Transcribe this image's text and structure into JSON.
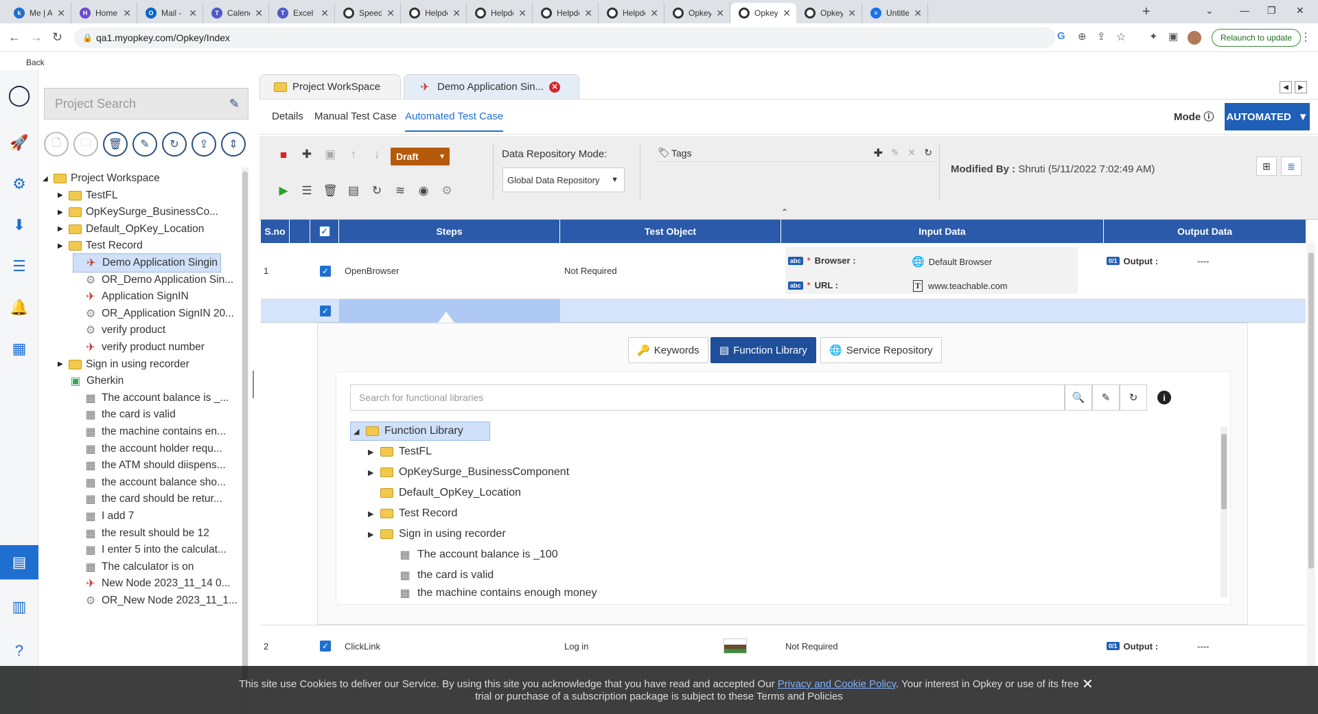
{
  "browser": {
    "tabs": [
      {
        "title": "Me | Atte",
        "fav": "k",
        "color": "#1f6fd1"
      },
      {
        "title": "Home | M",
        "fav": "H",
        "color": "#6a4ad1"
      },
      {
        "title": "Mail - Sa",
        "fav": "O",
        "color": "#0a64c8"
      },
      {
        "title": "Calendar",
        "fav": "T",
        "color": "#5059c9"
      },
      {
        "title": "Excel | M",
        "fav": "T",
        "color": "#5059c9"
      },
      {
        "title": "Speed up",
        "fav": "",
        "color": "ring"
      },
      {
        "title": "Helpdesk",
        "fav": "",
        "color": "ring"
      },
      {
        "title": "Helpdesk",
        "fav": "",
        "color": "ring"
      },
      {
        "title": "Helpdesk",
        "fav": "",
        "color": "ring"
      },
      {
        "title": "Helpdesk",
        "fav": "",
        "color": "ring"
      },
      {
        "title": "Opkey La",
        "fav": "",
        "color": "ring"
      },
      {
        "title": "Opkey",
        "fav": "",
        "color": "ring"
      },
      {
        "title": "Opkey Ur",
        "fav": "",
        "color": "ring"
      },
      {
        "title": "Untitled",
        "fav": "≡",
        "color": "#1a73e8"
      }
    ],
    "url": "qa1.myopkey.com/Opkey/Index",
    "relaunch": "Relaunch to update",
    "back": "Back"
  },
  "sidebar": {
    "search_placeholder": "Project Search",
    "tree": [
      {
        "label": "Project Workspace",
        "type": "folder",
        "level": 0,
        "expand": "open"
      },
      {
        "label": "TestFL",
        "type": "folder",
        "level": 1,
        "expand": "closed"
      },
      {
        "label": "OpKeySurge_BusinessCo...",
        "type": "folder",
        "level": 1,
        "expand": "closed"
      },
      {
        "label": "Default_OpKey_Location",
        "type": "folder",
        "level": 1,
        "expand": "closed"
      },
      {
        "label": "Test Record",
        "type": "folder",
        "level": 1,
        "expand": "closed"
      },
      {
        "label": "Demo Application Singin",
        "type": "tc",
        "level": 2,
        "selected": true
      },
      {
        "label": "OR_Demo Application Sin...",
        "type": "or",
        "level": 2
      },
      {
        "label": "Application SignIN",
        "type": "tc",
        "level": 2
      },
      {
        "label": "OR_Application SignIN 20...",
        "type": "or",
        "level": 2
      },
      {
        "label": "verify product",
        "type": "or",
        "level": 2
      },
      {
        "label": "verify product number",
        "type": "tc",
        "level": 2
      },
      {
        "label": "Sign in using recorder",
        "type": "folder",
        "level": 1,
        "expand": "closed"
      },
      {
        "label": "Gherkin",
        "type": "gherkin",
        "level": 1
      },
      {
        "label": "The account balance is _...",
        "type": "bc",
        "level": 2
      },
      {
        "label": "the card is valid",
        "type": "bc",
        "level": 2
      },
      {
        "label": "the machine contains en...",
        "type": "bc",
        "level": 2
      },
      {
        "label": "the account holder requ...",
        "type": "bc",
        "level": 2
      },
      {
        "label": "the ATM should diispens...",
        "type": "bc",
        "level": 2
      },
      {
        "label": "the account balance sho...",
        "type": "bc",
        "level": 2
      },
      {
        "label": "the card should be retur...",
        "type": "bc",
        "level": 2
      },
      {
        "label": "I add 7",
        "type": "bc",
        "level": 2
      },
      {
        "label": "the result should be 12",
        "type": "bc",
        "level": 2
      },
      {
        "label": "I enter 5 into the calculat...",
        "type": "bc",
        "level": 2
      },
      {
        "label": "The calculator is on",
        "type": "bc",
        "level": 2
      },
      {
        "label": "New Node 2023_11_14 0...",
        "type": "tc",
        "level": 2
      },
      {
        "label": "OR_New Node 2023_11_1...",
        "type": "or",
        "level": 2
      }
    ]
  },
  "workspace": {
    "tab_workspace": "Project WorkSpace",
    "tab_active": "Demo Application Sin...",
    "subtabs": [
      "Details",
      "Manual Test Case",
      "Automated Test Case"
    ],
    "mode_label": "Mode",
    "mode_value": "AUTOMATED"
  },
  "toolbar": {
    "status": "Draft",
    "drm_label": "Data Repository Mode:",
    "drm_value": "Global Data Repository",
    "tags_label": "Tags",
    "modified_label": "Modified By :",
    "modified_value": "Shruti (5/11/2022 7:02:49 AM)"
  },
  "grid": {
    "headers": [
      "S.no",
      "",
      "Steps",
      "Test Object",
      "Input Data",
      "Output Data"
    ],
    "rows": [
      {
        "sno": "1",
        "step": "OpenBrowser",
        "object": "Not Required",
        "inputs": [
          {
            "label": "Browser :",
            "value": "Default Browser"
          },
          {
            "label": "URL :",
            "value": "www.teachable.com"
          }
        ],
        "output_label": "Output :",
        "output_value": "----"
      },
      {
        "sno": "2",
        "step": "ClickLink",
        "object": "Log in",
        "input_text": "Not Required",
        "output_label": "Output :",
        "output_value": "----"
      }
    ]
  },
  "library_panel": {
    "buttons": [
      "Keywords",
      "Function Library",
      "Service Repository"
    ],
    "search_placeholder": "Search for functional libraries",
    "tree": [
      {
        "label": "Function Library",
        "type": "folder",
        "level": 0,
        "expand": "open",
        "selected": true
      },
      {
        "label": "TestFL",
        "type": "folder",
        "level": 1,
        "expand": "closed"
      },
      {
        "label": "OpKeySurge_BusinessComponent",
        "type": "folder",
        "level": 1,
        "expand": "closed"
      },
      {
        "label": "Default_OpKey_Location",
        "type": "folder",
        "level": 1
      },
      {
        "label": "Test Record",
        "type": "folder",
        "level": 1,
        "expand": "closed"
      },
      {
        "label": "Sign in using recorder",
        "type": "folder",
        "level": 1,
        "expand": "closed"
      },
      {
        "label": "The account balance is _100",
        "type": "bc",
        "level": 2
      },
      {
        "label": "the card is valid",
        "type": "bc",
        "level": 2
      },
      {
        "label": "the machine contains enough money",
        "type": "bc",
        "level": 2
      }
    ]
  },
  "cookie": {
    "text_before": "This site use Cookies to deliver our Service. By using this site you acknowledge that you have read and accepted Our ",
    "link": "Privacy and Cookie Policy",
    "text_after": ". Your interest in Opkey or use of its free",
    "line2": "trial or purchase of a subscription package is subject to these Terms and Policies"
  }
}
